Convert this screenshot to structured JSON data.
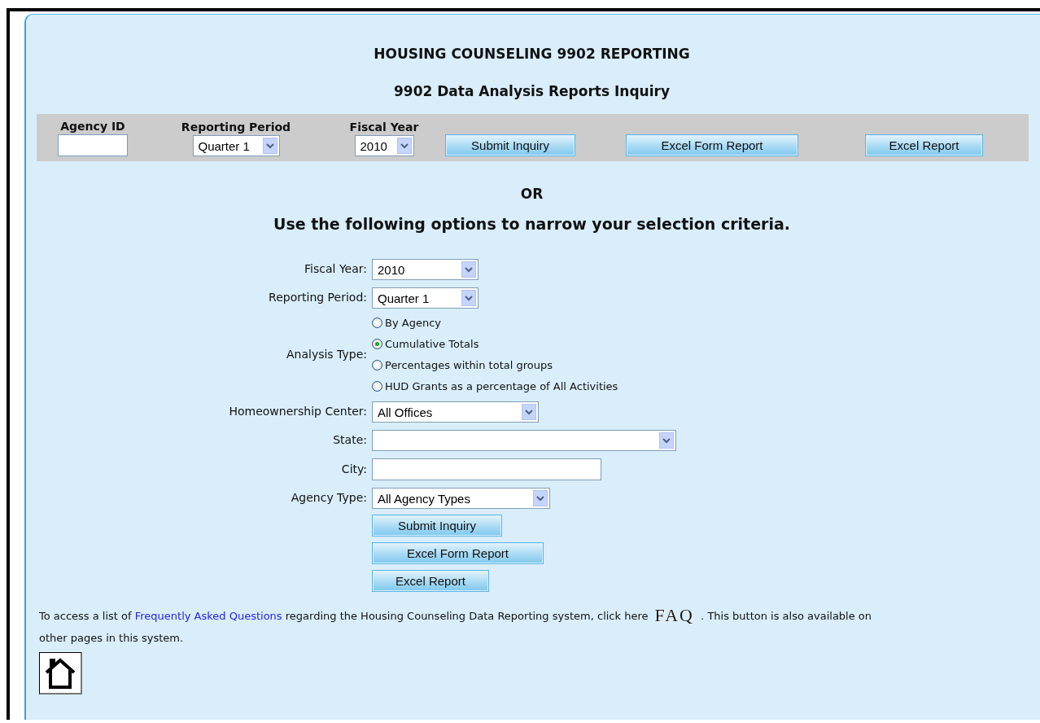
{
  "title": "HOUSING COUNSELING 9902 REPORTING",
  "subtitle": "9902 Data Analysis Reports Inquiry",
  "quick_inquiry": {
    "agency_id": {
      "label": "Agency ID"
    },
    "reporting_period": {
      "label": "Reporting Period",
      "value": "Quarter 1"
    },
    "fiscal_year": {
      "label": "Fiscal Year",
      "value": "2010"
    },
    "buttons": [
      "Submit Inquiry",
      "Excel Form Report",
      "Excel Report"
    ]
  },
  "or_text": "OR",
  "instructions": "Use the following options to narrow your selection criteria.",
  "criteria": [
    {
      "kind": "select",
      "label": "Fiscal Year:",
      "value": "2010"
    },
    {
      "kind": "select",
      "label": "Reporting Period:",
      "value": "Quarter 1"
    },
    {
      "kind": "radio",
      "label": "Analysis Type:",
      "options": [
        {
          "label": "By Agency",
          "selected": false
        },
        {
          "label": "Cumulative Totals",
          "selected": true
        },
        {
          "label": "Percentages within total groups",
          "selected": false
        },
        {
          "label": "HUD Grants as a percentage of All Activities",
          "selected": false
        }
      ]
    },
    {
      "kind": "select",
      "label": "Homeownership Center:",
      "value": "All Offices"
    },
    {
      "kind": "select",
      "label": "State:"
    },
    {
      "kind": "text",
      "label": "City:"
    },
    {
      "kind": "select",
      "label": "Agency Type:",
      "value": "All Agency Types"
    }
  ],
  "buttons": [
    "Submit Inquiry",
    "Excel Form Report",
    "Excel Report"
  ],
  "footer": {
    "before_link": "To access a list of ",
    "link": "Frequently Asked Questions",
    "middle": " regarding the Housing Counseling Data Reporting system, click here ",
    "faq_button": "FAQ",
    "after": " . This button is also available on other pages in this system."
  }
}
